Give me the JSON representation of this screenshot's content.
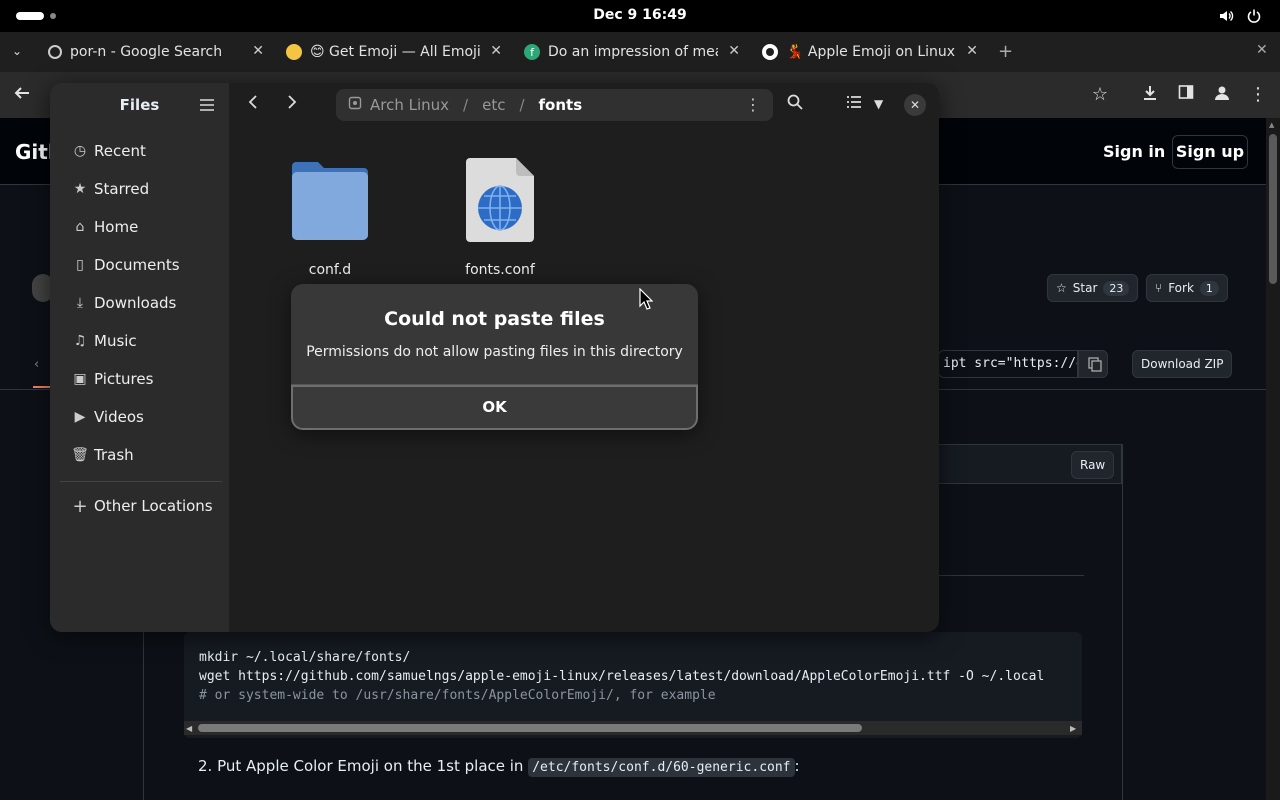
{
  "topbar": {
    "clock": "Dec 9  16:49"
  },
  "browser": {
    "tabs": [
      {
        "title": "por-n - Google Search",
        "favicon": "google-icon"
      },
      {
        "title": "😊 Get Emoji — All Emoji",
        "favicon": "emoji-icon"
      },
      {
        "title": "Do an impression of mea",
        "favicon": "poe-icon"
      },
      {
        "title": "💃 Apple Emoji on Linux",
        "favicon": "github-icon"
      }
    ],
    "new_tab": "+"
  },
  "github": {
    "logo_partial": "Gith",
    "sign_in": "Sign in",
    "sign_up": "Sign up",
    "star_label": "Star",
    "star_count": "23",
    "fork_label": "Fork",
    "fork_count": "1",
    "embed_snippet": "ipt src=\"https://g",
    "download_zip": "Download ZIP",
    "raw": "Raw",
    "code_lines": [
      "mkdir ~/.local/share/fonts/",
      "wget https://github.com/samuelngs/apple-emoji-linux/releases/latest/download/AppleColorEmoji.ttf -O ~/.local",
      "# or system-wide to /usr/share/fonts/AppleColorEmoji/, for example"
    ],
    "step2_prefix": "2. Put Apple Color Emoji on the 1st place in",
    "step2_code": "/etc/fonts/conf.d/60-generic.conf",
    "step2_suffix": ":"
  },
  "files": {
    "app_title": "Files",
    "sidebar": [
      {
        "label": "Recent",
        "icon": "clock-icon"
      },
      {
        "label": "Starred",
        "icon": "star-icon"
      },
      {
        "label": "Home",
        "icon": "home-icon"
      },
      {
        "label": "Documents",
        "icon": "document-icon"
      },
      {
        "label": "Downloads",
        "icon": "download-icon"
      },
      {
        "label": "Music",
        "icon": "music-icon"
      },
      {
        "label": "Pictures",
        "icon": "picture-icon"
      },
      {
        "label": "Videos",
        "icon": "video-icon"
      },
      {
        "label": "Trash",
        "icon": "trash-icon"
      }
    ],
    "other_locations": "Other Locations",
    "path": [
      "Arch Linux",
      "etc",
      "fonts"
    ],
    "path_sep": "/",
    "items": [
      {
        "name": "conf.d",
        "type": "folder"
      },
      {
        "name": "fonts.conf",
        "type": "xml-file"
      }
    ]
  },
  "dialog": {
    "title": "Could not paste files",
    "message": "Permissions do not allow pasting files in this directory",
    "ok": "OK"
  }
}
